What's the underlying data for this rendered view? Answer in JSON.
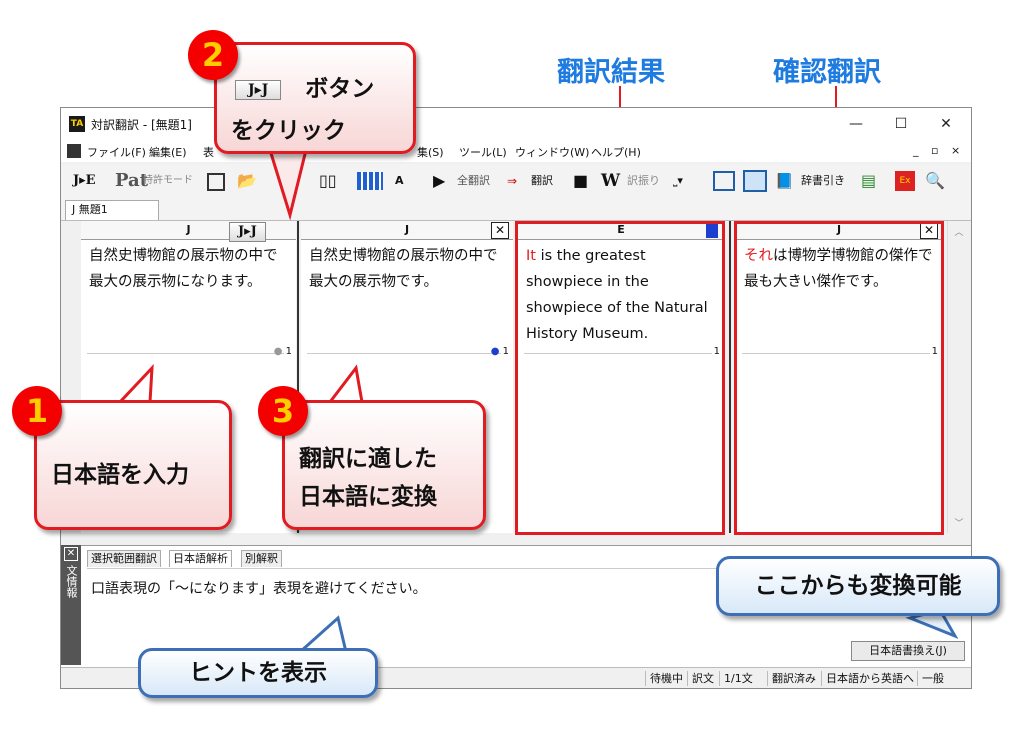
{
  "headings": {
    "result": "翻訳結果",
    "confirm": "確認翻訳"
  },
  "window": {
    "title": "対訳翻訳 - [無題1]",
    "min": "—",
    "max": "☐",
    "close": "✕"
  },
  "menu": [
    "ファイル(F)",
    "編集(E)",
    "表",
    "集(S)",
    "ツール(L)",
    "ウィンドウ(W)",
    "ヘルプ(H)"
  ],
  "toolbar": {
    "je": "J▸E",
    "pat": "Pat",
    "patent_mode": "特許モード",
    "all_translate": "全翻訳",
    "translate": "翻訳",
    "stop": "■",
    "wordmark": "W",
    "word_translate": "訳振り",
    "dictionary": "辞書引き",
    "jj": "J▸J"
  },
  "doc_tab": "J  無題1",
  "panes": {
    "p1": {
      "head": "J",
      "text": "自然史博物館の展示物の中で最大の展示物になります。",
      "num": "1"
    },
    "p2": {
      "head": "J",
      "text": "自然史博物館の展示物の中で最大の展示物です。",
      "num": "1"
    },
    "p3": {
      "head": "E",
      "text_first": "It",
      "text_rest": " is the greatest showpiece in the showpiece of the Natural History Museum.",
      "num": "1"
    },
    "p4": {
      "head": "J",
      "text_first": "それ",
      "text_rest": "は博物学博物館の傑作で最も大きい傑作です。",
      "num": "1"
    }
  },
  "info": {
    "side": "文情報",
    "tabs": [
      "選択範囲翻訳",
      "日本語解析",
      "別解釈"
    ],
    "hint": "口語表現の「～になります」表現を避けてください。",
    "rewrite_button": "日本語書換え(J)"
  },
  "status": [
    "待機中",
    "訳文",
    "1/1文",
    "翻訳済み",
    "日本語から英語へ",
    "一般"
  ],
  "callouts": {
    "c1": {
      "num": "1",
      "text": "日本語を入力"
    },
    "c2": {
      "num": "2",
      "line1": "ボタン",
      "line2": "をクリック"
    },
    "c3": {
      "num": "3",
      "line1": "翻訳に適した",
      "line2": "日本語に変換"
    },
    "hint": "ヒントを表示",
    "convert": "ここからも変換可能"
  }
}
